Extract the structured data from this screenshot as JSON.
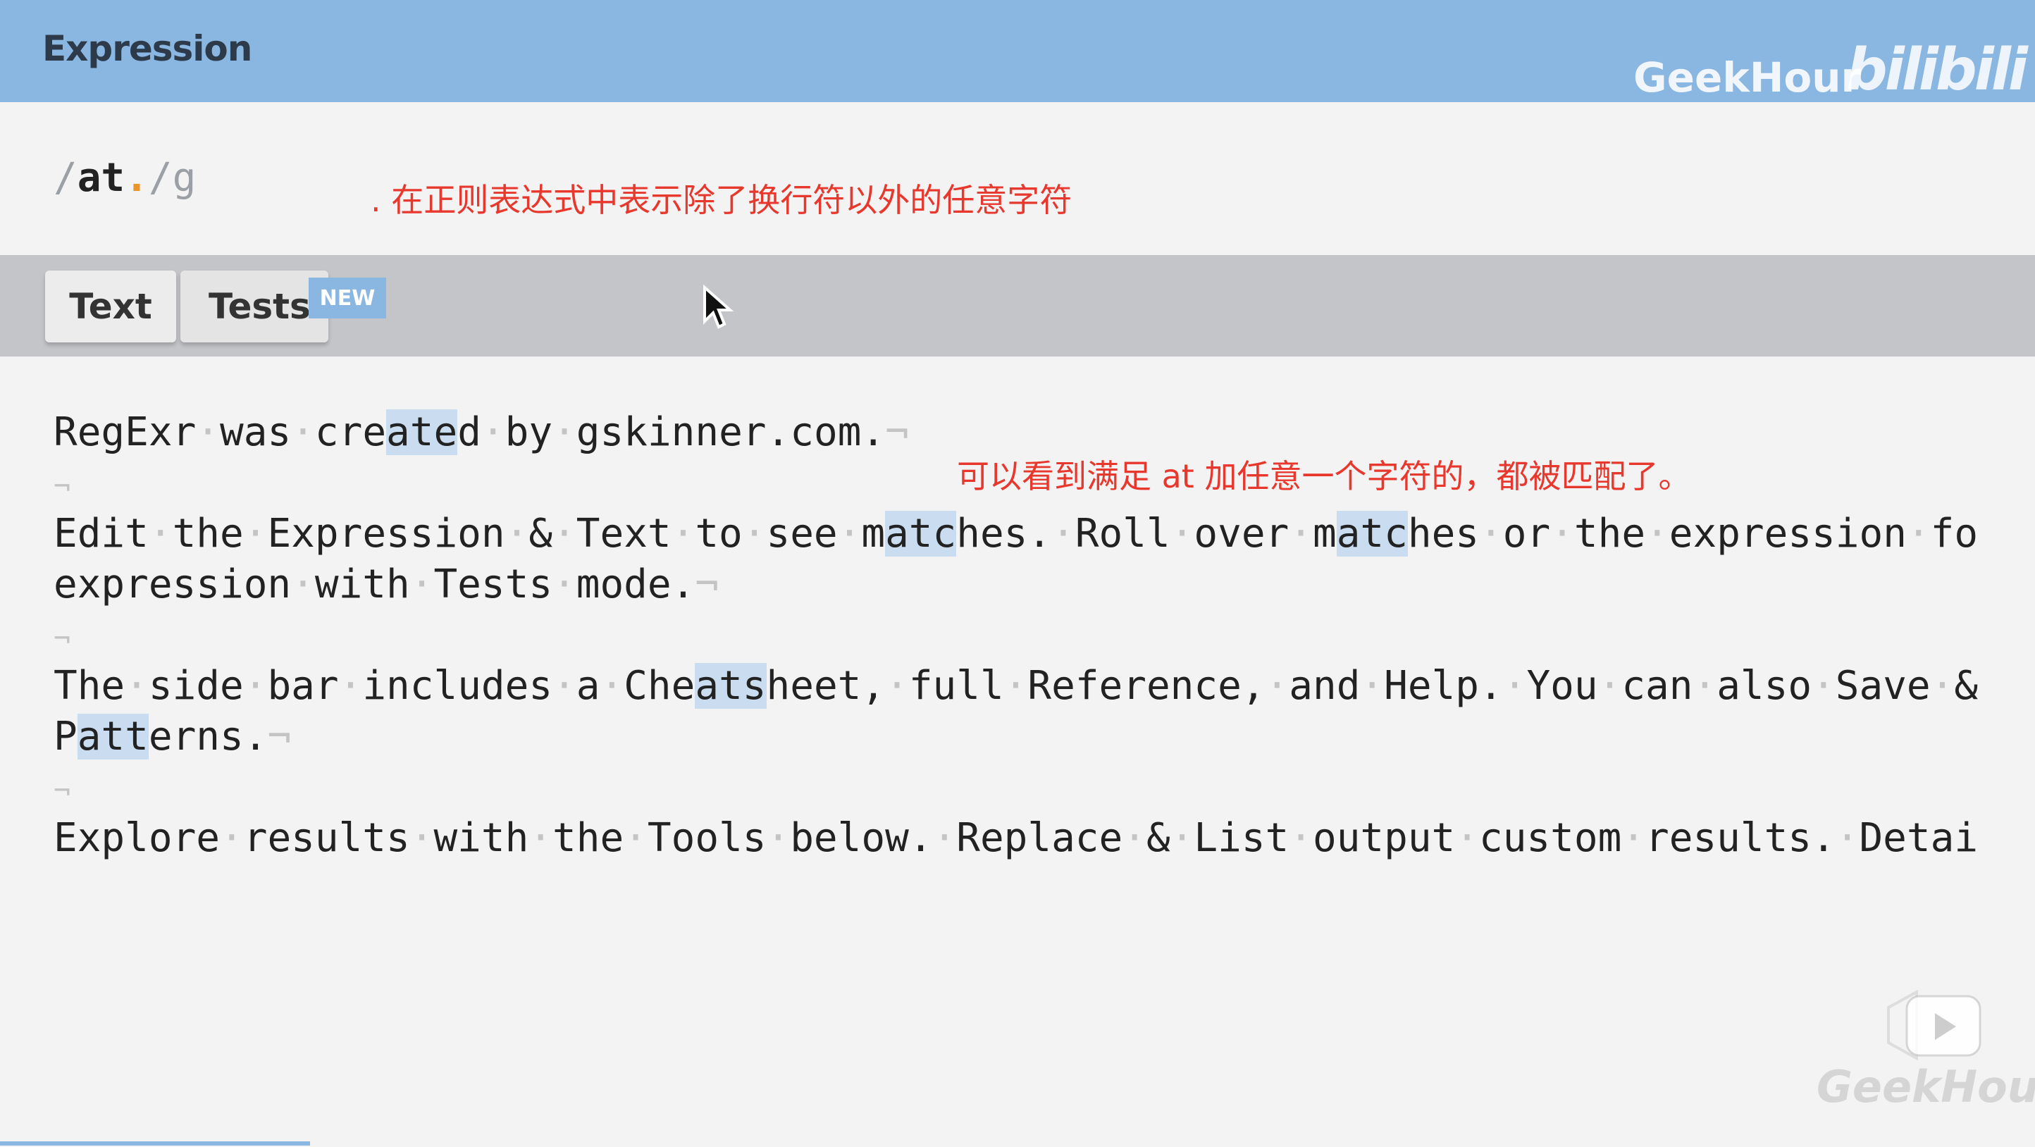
{
  "header": {
    "title": "Expression",
    "watermark_brand": "GeekHour",
    "watermark_logo": "bilibili"
  },
  "expression": {
    "open_delim": "/",
    "literal": "at",
    "dot": ".",
    "close_delim": "/",
    "flags": "g"
  },
  "annotations": {
    "dot_note": ". 在正则表达式中表示除了换行符以外的任意字符",
    "match_note": "可以看到满足 at 加任意一个字符的，都被匹配了。"
  },
  "tabs": {
    "text_label": "Text",
    "tests_label": "Tests",
    "new_badge": "NEW"
  },
  "text_body": {
    "line1": "RegExr·was·created·by·gskinner.com.¬",
    "line2": "Edit·the·Expression·&·Text·to·see·matches.·Roll·over·matches·or·the·expression·fo",
    "line3": "expression·with·Tests·mode.¬",
    "line4": "The·side·bar·includes·a·Cheatsheet,·full·Reference,·and·Help.·You·can·also·Save·&",
    "line5": "Patterns.¬",
    "line6": "Explore·results·with·the·Tools·below.·Replace·&·List·output·custom·results.·Detai"
  },
  "footer": {
    "watermark_text": "GeekHour"
  },
  "colors": {
    "accent": "#8ab7e1",
    "match_highlight": "#c9dcf0",
    "annotation": "#e8372c",
    "dot_token": "#e8952b"
  }
}
